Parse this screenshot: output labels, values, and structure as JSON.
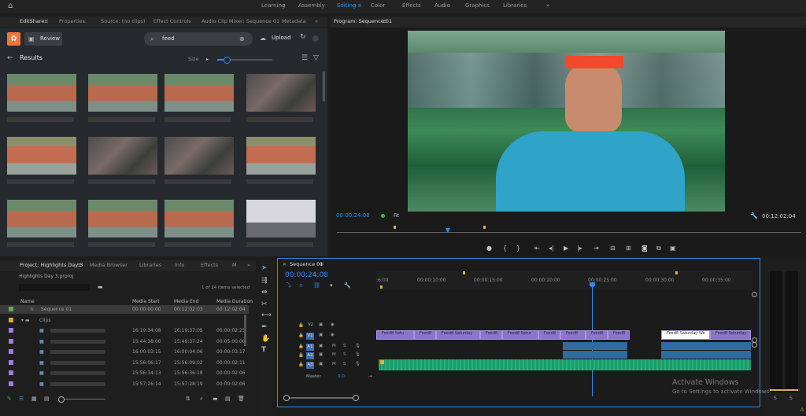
{
  "colors": {
    "accent": "#2d8ceb",
    "clip_video": "#8b74c9",
    "clip_audio": "#1c9c6a",
    "playhead": "#2d8ceb"
  },
  "workspaces": [
    "Learning",
    "Assembly",
    "Editing",
    "Color",
    "Effects",
    "Audio",
    "Graphics",
    "Libraries"
  ],
  "active_workspace": "Editing",
  "source_tabs": [
    "EditShare",
    "Properties:",
    "Source: (no clips)",
    "Effect Controls",
    "Audio Clip Mixer: Sequence 01",
    "Metadata"
  ],
  "program_tab": "Program: Sequence 01",
  "editshare": {
    "review_label": "Review",
    "search_value": "feed",
    "upload_label": "Upload",
    "results_label": "Results",
    "size_label": "Size"
  },
  "program": {
    "timecode": "00:00:24:08",
    "fit": "Fit",
    "duration": "00:12:02:04"
  },
  "project_tabs": [
    "Project: Highlights Day 3",
    "Media Browser",
    "Libraries",
    "Info",
    "Effects",
    "M"
  ],
  "project": {
    "file": "Highlights Day 3.prproj",
    "items_selected": "1 of 24 items selected",
    "columns": [
      "Name",
      "Media Start",
      "Media End",
      "Media Duration"
    ],
    "rows": [
      {
        "name": "Sequence 01",
        "start": "00:00:00:00",
        "end": "00:12:02:03",
        "duration": "00:12:02:04",
        "color": "#5aae5a"
      },
      {
        "name": "Clips",
        "start": "",
        "end": "",
        "duration": "",
        "color": "#e0a040"
      },
      {
        "name": "",
        "start": "16:19:34:08",
        "end": "16:19:37:05",
        "duration": "00:00:02:23",
        "color": "#9b7ee0"
      },
      {
        "name": "",
        "start": "15:44:38:00",
        "end": "15:49:37:24",
        "duration": "00:05:00:00",
        "color": "#9b7ee0"
      },
      {
        "name": "",
        "start": "16:00:03:15",
        "end": "16:00:04:06",
        "duration": "00:00:03:17",
        "color": "#9b7ee0"
      },
      {
        "name": "",
        "start": "15:56:06:17",
        "end": "15:56:09:02",
        "duration": "00:00:02:11",
        "color": "#9b7ee0"
      },
      {
        "name": "",
        "start": "15:56:34:13",
        "end": "15:56:36:18",
        "duration": "00:00:02:06",
        "color": "#9b7ee0"
      },
      {
        "name": "",
        "start": "15:57:26:14",
        "end": "15:57:28:19",
        "duration": "00:00:02:06",
        "color": "#9b7ee0"
      }
    ]
  },
  "timeline": {
    "sequence_tab": "Sequence 01",
    "timecode": "00:00:24:08",
    "ruler": [
      ":6:00",
      "00:00:10:00",
      "00:00:15:00",
      "00:00:20:00",
      "00:00:25:00",
      "00:00:30:00",
      "00:00:35:00"
    ],
    "tracks": [
      "V2",
      "V1",
      "A1",
      "A2",
      "A3"
    ],
    "master_label": "Master",
    "master_value": "0.0",
    "clip_labels": [
      "Feed8 Satu",
      "Feed8",
      "Feed8 Saturday",
      "Feed8",
      "Feed8 Satur",
      "Feed8",
      "Feed8",
      "Feed8",
      "Feed8",
      "Feed8 Saturday Wo",
      "Feed8 Saturday"
    ],
    "meter_labels": [
      "S",
      "S"
    ]
  },
  "watermark": {
    "title": "Activate Windows",
    "subtitle": "Go to Settings to activate Windows."
  }
}
